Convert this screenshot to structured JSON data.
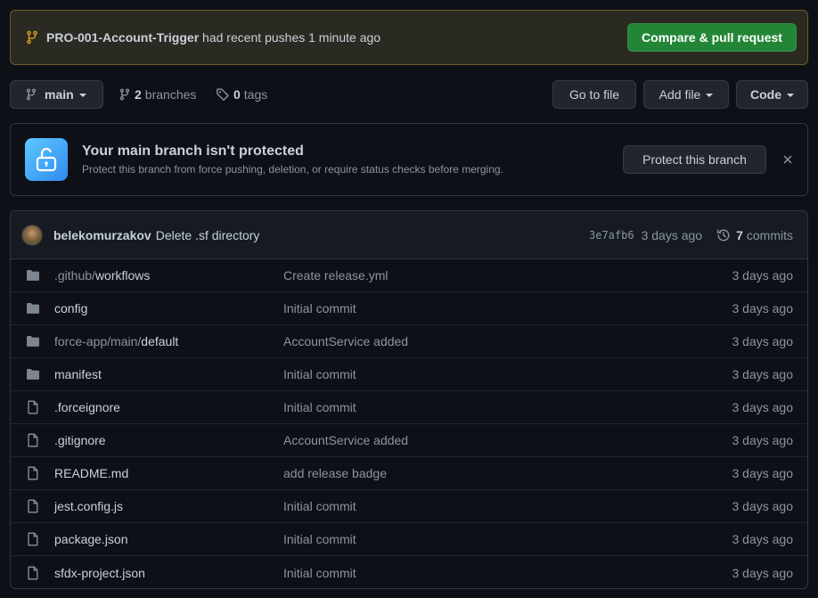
{
  "banner": {
    "branch_name": "PRO-001-Account-Trigger",
    "text": "had recent pushes 1 minute ago",
    "compare_label": "Compare & pull request"
  },
  "toolbar": {
    "branch_label": "main",
    "branches_count": "2",
    "branches_label": "branches",
    "tags_count": "0",
    "tags_label": "tags",
    "go_to_file": "Go to file",
    "add_file": "Add file",
    "code": "Code"
  },
  "protect": {
    "title": "Your main branch isn't protected",
    "subtitle": "Protect this branch from force pushing, deletion, or require status checks before merging.",
    "button": "Protect this branch"
  },
  "commit": {
    "author": "belekomurzakov",
    "message": "Delete .sf directory",
    "hash": "3e7afb6",
    "time": "3 days ago",
    "count": "7",
    "count_label": "commits"
  },
  "files": [
    {
      "type": "folder",
      "prefix": ".github/",
      "name": "workflows",
      "message": "Create release.yml",
      "date": "3 days ago"
    },
    {
      "type": "folder",
      "prefix": "",
      "name": "config",
      "message": "Initial commit",
      "date": "3 days ago"
    },
    {
      "type": "folder",
      "prefix": "force-app/main/",
      "name": "default",
      "message": "AccountService added",
      "date": "3 days ago"
    },
    {
      "type": "folder",
      "prefix": "",
      "name": "manifest",
      "message": "Initial commit",
      "date": "3 days ago"
    },
    {
      "type": "file",
      "prefix": "",
      "name": ".forceignore",
      "message": "Initial commit",
      "date": "3 days ago"
    },
    {
      "type": "file",
      "prefix": "",
      "name": ".gitignore",
      "message": "AccountService added",
      "date": "3 days ago"
    },
    {
      "type": "file",
      "prefix": "",
      "name": "README.md",
      "message": "add release badge",
      "date": "3 days ago"
    },
    {
      "type": "file",
      "prefix": "",
      "name": "jest.config.js",
      "message": "Initial commit",
      "date": "3 days ago"
    },
    {
      "type": "file",
      "prefix": "",
      "name": "package.json",
      "message": "Initial commit",
      "date": "3 days ago"
    },
    {
      "type": "file",
      "prefix": "",
      "name": "sfdx-project.json",
      "message": "Initial commit",
      "date": "3 days ago"
    }
  ]
}
